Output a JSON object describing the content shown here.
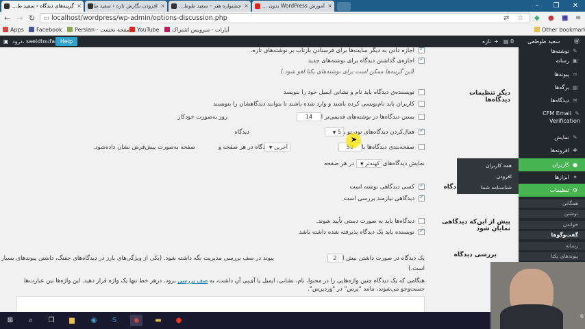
{
  "browser": {
    "tabs": [
      {
        "title": "گزینه‌های دیدگاه ‹ سعید ط...",
        "active": true
      },
      {
        "title": "افزودن نگارش تازه ‹ سعید ط...",
        "active": false
      },
      {
        "title": "جشنواره هنر – سعید طوط...",
        "active": false
      },
      {
        "title": "آموزش WordPress بدون ...",
        "active": false
      }
    ],
    "url": "localhost/wordpress/wp-admin/options-discussion.php",
    "bookmarks": [
      "Apps",
      "Facebook",
      "Persian - صفحه نخست",
      "YouTube",
      "آپارات - سرویس اشتراک",
      "Other bookmarks"
    ]
  },
  "adminbar": {
    "site_name": "سعید طوطفی",
    "new_label": "تازه",
    "comment_count": "0",
    "greeting": "درود، saeidtoufani",
    "help": "Help"
  },
  "content": {
    "top_lines": [
      "اجازه دادن به دیگر سایت‌ها برای فرستادن بازتاب بر نوشته‌های تازه.",
      "اجازه‌ی گذاشتن دیدگاه برای نوشته‌های جدید",
      "(این گزینه‌ها ممکن است برای نوشته‌های یکتا لغو شود.)"
    ],
    "other_settings_label": "دیگر تنظیمات دیدگاه‌ها",
    "other_settings": {
      "require_name_email": "نویسنده‌ی دیدگاه باید نام و نشانی ایمیل خود را بنویسد",
      "registered_only": "کاربران باید نام‌نویسی کرده باشند و وارد شده باشند تا بتوانند دیدگاهشان را بنویسند",
      "close_prefix": "بستن دیدگاه‌ها در نوشته‌های قدیمی‌تر از",
      "close_days": "14",
      "close_suffix": "روز به‌صورت خودکار",
      "threaded_prefix": "فعال‌کردن دیدگاه‌های تودرتو یا عمق",
      "threaded_depth": "5",
      "threaded_suffix": "دیدگاه",
      "paginate_prefix": "صفحه‌بندی دیدگاه‌ها با",
      "paginate_count": "50",
      "paginate_mid": "دیدگاه در هر صفحه و",
      "paginate_page": "آخرین",
      "paginate_suffix": "صفحه به‌صورت پیش‌فرض نشان داده‌شود.",
      "display_prefix": "نمایش دیدگاه‌های",
      "display_order": "کهنه‌تر",
      "display_suffix": "در هر صفحه"
    },
    "email_label_partial": "دگاه",
    "email_me": {
      "anyone_posts": "کسی دیدگاهی نوشته است",
      "held_moderation": "دیدگاهی نیازمند بررسی است"
    },
    "before_appears_label": "پیش از این‌که دیدگاهی نمایان شود",
    "before_appears": {
      "manual_approve": "دیدگاه‌ها باید به صورت دستی تأیید شوند.",
      "previous_approved": "نویسنده باید یک دیدگاه پذیرفته شده داشته باشد"
    },
    "moderation_label": "بررسی دیدگاه",
    "moderation": {
      "hold_prefix": "یک دیدگاه در صورت داشتن بیش از",
      "hold_links": "2",
      "hold_suffix": "پیوند در صف بررسی مدیریت نگه داشته شود. (یکی از ویژگی‌های بارز در دیدگاه‌های جفنگ، داشتن پیوندهای بسیار در متن دیدگاه",
      "hold_suffix2": "است.)",
      "words_text": "هنگامی که یک دیدگاه چنین واژه‌هایی را در محتوا، نام، نشانی، ایمیل یا آی‌پی آن داشت، به",
      "words_link": "صف بررسی",
      "words_text2": "برود. درهر خط تنها یک واژه قرار دهید. این واژه‌ها تین عبارت‌ها جست‌وجو",
      "words_text3": "می‌شوند، مانند \"پرس\" در \"وردپرس\"."
    }
  },
  "sidebar": {
    "items": [
      {
        "label": "نوشته‌ها",
        "icon": "pin-icon"
      },
      {
        "label": "رسانه",
        "icon": "media-icon"
      },
      {
        "label": "پیوندها",
        "icon": "link-icon"
      },
      {
        "label": "برگه‌ها",
        "icon": "page-icon"
      },
      {
        "label": "دیدگاه‌ها",
        "icon": "comment-icon"
      },
      {
        "label": "CFM Email Verification",
        "icon": "plugin-icon"
      },
      {
        "label": "نمایش",
        "icon": "brush-icon"
      },
      {
        "label": "افزونه‌ها",
        "icon": "plug-icon"
      },
      {
        "label": "کاربران",
        "icon": "user-icon"
      },
      {
        "label": "ابزارها",
        "icon": "tools-icon"
      },
      {
        "label": "تنظیمات",
        "icon": "settings-icon"
      }
    ],
    "settings_sub": [
      "همگانی",
      "نوشتن",
      "خواندن",
      "گفت‌وگوها",
      "رسانه",
      "پیوندهای یکتا"
    ],
    "users_flyout": [
      "همه کاربران",
      "افزودن",
      "شناسنامه شما"
    ]
  },
  "taskbar": {
    "clock": "6"
  },
  "colors": {
    "admin_bar": "#23282d",
    "accent": "#0073aa",
    "highlight": "#46b450"
  }
}
